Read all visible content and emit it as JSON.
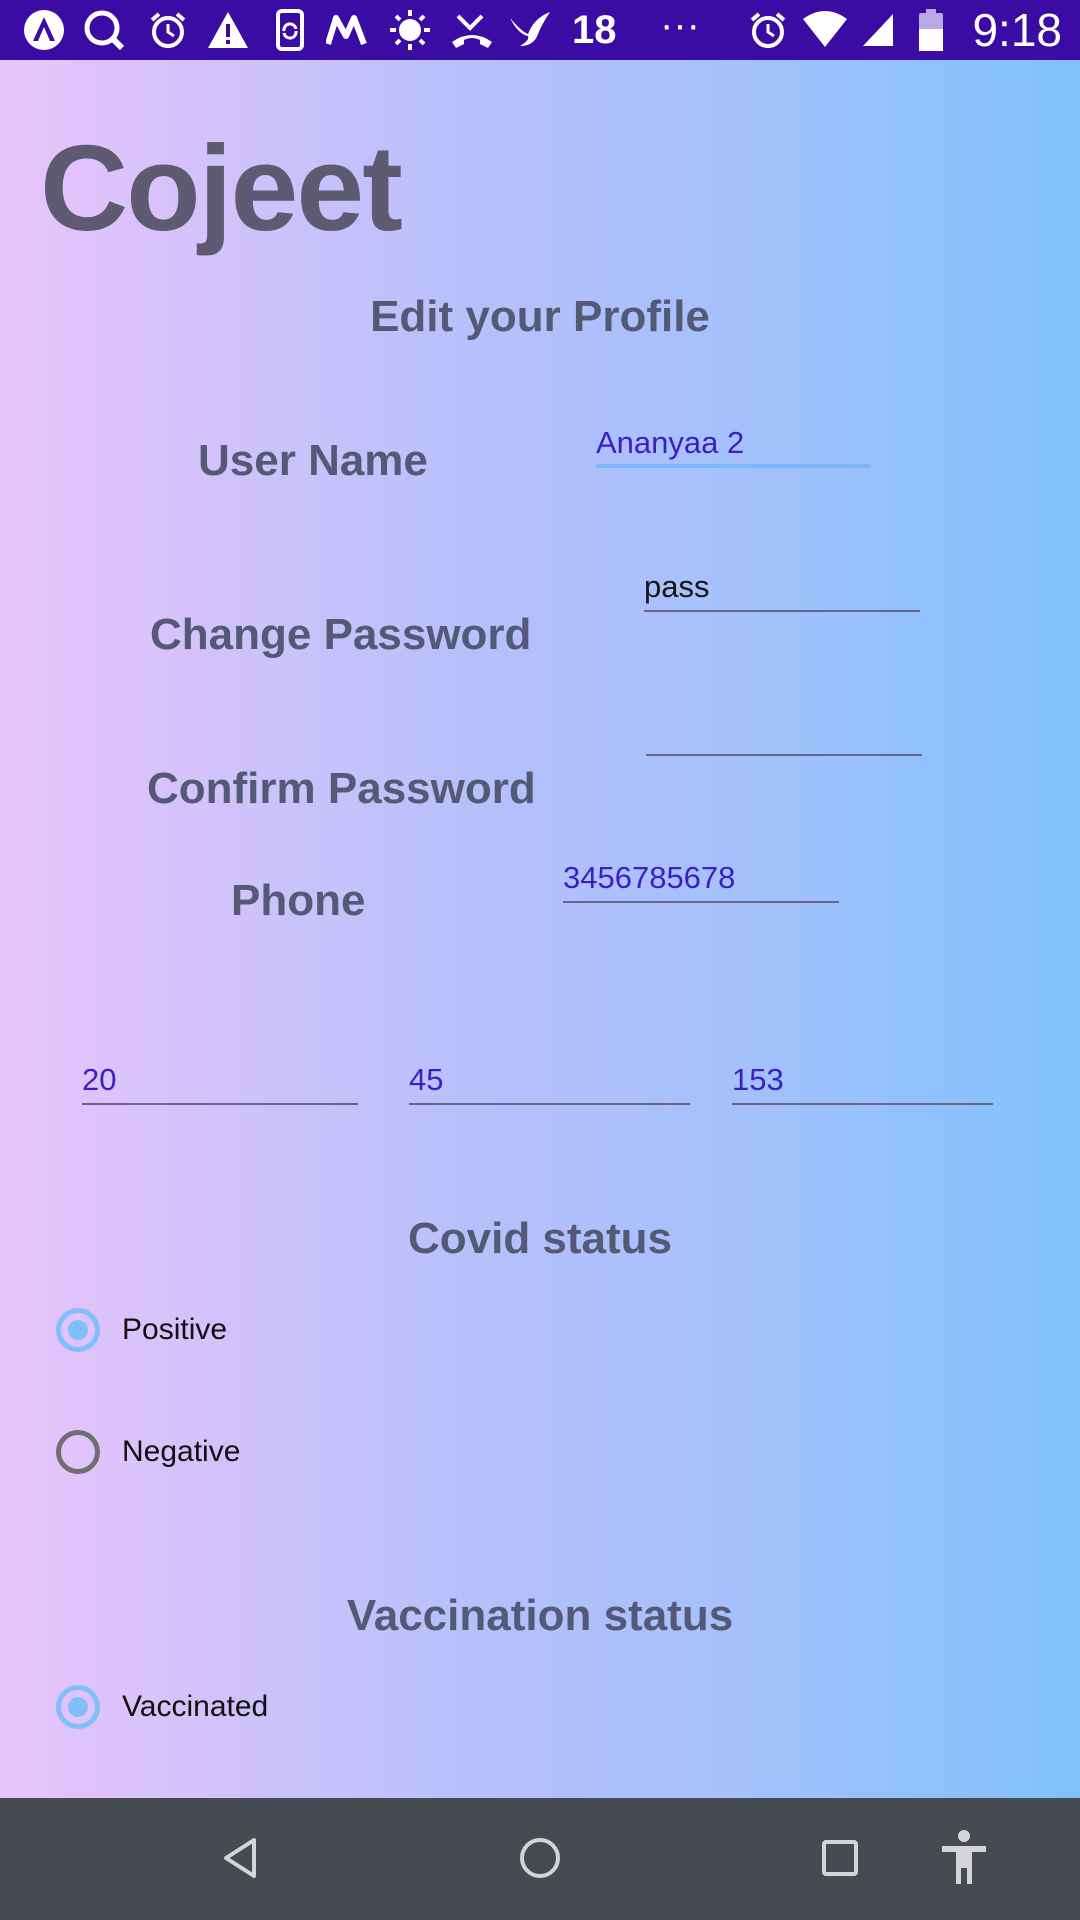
{
  "status_bar": {
    "notification_count": "18",
    "overflow": "···",
    "time": "9:18",
    "icons": [
      "app-a-icon",
      "search-icon",
      "alarm-icon",
      "warning-icon",
      "phone-sync-icon",
      "m-logo-icon",
      "brightness-icon",
      "missed-call-icon",
      "bird-icon",
      "alarm-icon",
      "wifi-icon",
      "signal-icon",
      "battery-icon"
    ]
  },
  "app": {
    "title": "Cojeet"
  },
  "form": {
    "heading": "Edit your Profile",
    "username": {
      "label": "User Name",
      "value": "Ananyaa 2"
    },
    "password": {
      "label": "Change Password",
      "value": "pass"
    },
    "confirm_password": {
      "label": "Confirm Password",
      "value": ""
    },
    "phone": {
      "label": "Phone",
      "value": "3456785678"
    },
    "numbers": [
      "20",
      "45",
      "153"
    ]
  },
  "covid": {
    "heading": "Covid status",
    "options": [
      {
        "label": "Positive",
        "checked": true
      },
      {
        "label": "Negative",
        "checked": false
      }
    ]
  },
  "vaccination": {
    "heading": "Vaccination status",
    "options": [
      {
        "label": "Vaccinated",
        "checked": true
      }
    ]
  },
  "colors": {
    "status_bar": "#3a0ca3",
    "accent": "#7fc0fb",
    "input_text": "#3a1fc3",
    "label_text": "#545a76",
    "nav_bar": "#454b51"
  }
}
